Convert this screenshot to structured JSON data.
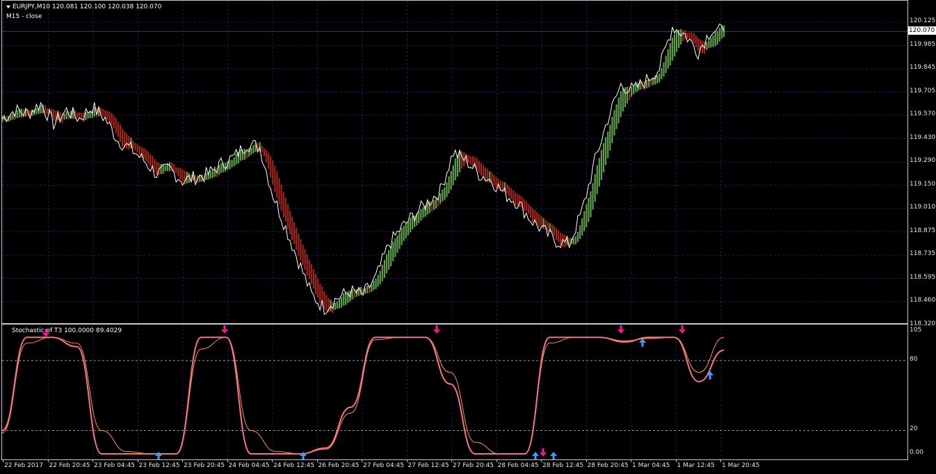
{
  "header": {
    "symbol_line": "EURJPY,M10  120.081 120.100 120.038 120.070",
    "indicator_line": "M15 - close"
  },
  "current_price": "120.070",
  "price_axis": [
    "120.125",
    "119.985",
    "119.845",
    "119.705",
    "119.570",
    "119.430",
    "119.290",
    "119.150",
    "119.010",
    "118.875",
    "118.735",
    "118.595",
    "118.460",
    "118.320"
  ],
  "stochastic": {
    "title": "Stochastic of T3 100.0000 89.4029",
    "levels": [
      "105",
      "80",
      "20",
      "0.00"
    ]
  },
  "time_axis": [
    "22 Feb 2017",
    "22 Feb 20:45",
    "23 Feb 04:45",
    "23 Feb 12:45",
    "23 Feb 20:45",
    "24 Feb 04:45",
    "24 Feb 12:45",
    "26 Feb 20:45",
    "27 Feb 04:45",
    "27 Feb 12:45",
    "27 Feb 20:45",
    "28 Feb 04:45",
    "28 Feb 12:45",
    "28 Feb 20:45",
    "1 Mar 04:45",
    "1 Mar 12:45",
    "1 Mar 20:45"
  ],
  "colors": {
    "background": "#000000",
    "grid": "#1c1c5a",
    "price_line": "#ffffff",
    "bull_histogram": "#5e9e4a",
    "bear_histogram": "#a3231d",
    "stoch_main": "#ff6f8f",
    "stoch_signal": "#ff9a3c",
    "arrow_up": "#3c9cff",
    "arrow_down": "#ff1493"
  },
  "chart_data": {
    "type": "line",
    "title": "EURJPY,M10",
    "ylim": [
      118.32,
      120.2
    ],
    "close_series": [
      119.55,
      119.6,
      119.58,
      119.64,
      119.52,
      119.6,
      119.55,
      119.62,
      119.55,
      119.42,
      119.37,
      119.3,
      119.22,
      119.25,
      119.18,
      119.2,
      119.22,
      119.28,
      119.32,
      119.4,
      119.38,
      119.1,
      118.9,
      118.7,
      118.5,
      118.42,
      118.48,
      118.52,
      118.5,
      118.6,
      118.8,
      118.9,
      118.98,
      119.05,
      119.12,
      119.35,
      119.3,
      119.22,
      119.18,
      119.1,
      119.05,
      118.95,
      118.88,
      118.82,
      118.8,
      119.0,
      119.3,
      119.55,
      119.75,
      119.72,
      119.78,
      119.85,
      120.1,
      120.05,
      119.95,
      120.08,
      120.07
    ],
    "stochastic_main": [
      20,
      100,
      100,
      92,
      0,
      0,
      0,
      0,
      100,
      100,
      0,
      0,
      0,
      5,
      40,
      100,
      100,
      100,
      60,
      0,
      0,
      0,
      100,
      100,
      100,
      96,
      100,
      100,
      62,
      89
    ],
    "stochastic_signal": [
      18,
      95,
      100,
      95,
      20,
      2,
      0,
      0,
      90,
      100,
      20,
      2,
      0,
      4,
      35,
      98,
      100,
      100,
      70,
      10,
      0,
      0,
      95,
      100,
      100,
      97,
      99,
      100,
      70,
      100
    ]
  }
}
